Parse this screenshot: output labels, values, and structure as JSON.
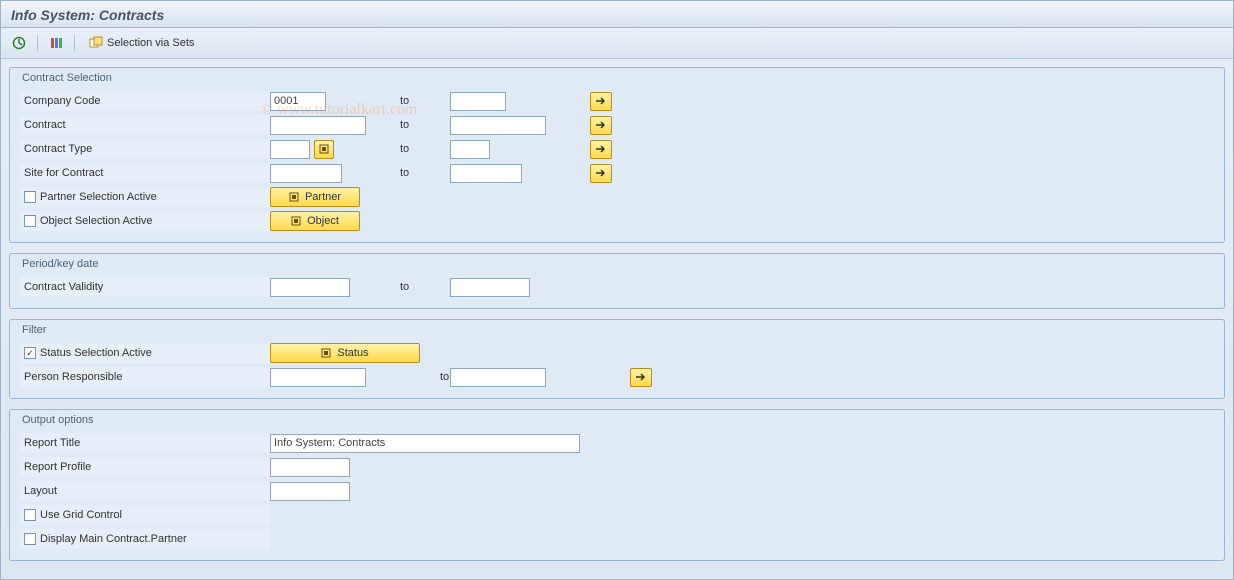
{
  "title": "Info System: Contracts",
  "toolbar": {
    "selection_via_sets": "Selection via Sets"
  },
  "watermark": "© www.tutorialkart.com",
  "contract_selection": {
    "legend": "Contract Selection",
    "rows": {
      "company_code": {
        "label": "Company Code",
        "from": "0001",
        "to_lbl": "to",
        "to": ""
      },
      "contract": {
        "label": "Contract",
        "from": "",
        "to_lbl": "to",
        "to": ""
      },
      "contract_type": {
        "label": "Contract Type",
        "from": "",
        "to_lbl": "to",
        "to": ""
      },
      "site": {
        "label": "Site for Contract",
        "from": "",
        "to_lbl": "to",
        "to": ""
      }
    },
    "partner_active": {
      "label": "Partner Selection Active",
      "checked": false,
      "btn": "Partner"
    },
    "object_active": {
      "label": "Object Selection Active",
      "checked": false,
      "btn": "Object"
    }
  },
  "period": {
    "legend": "Period/key date",
    "validity": {
      "label": "Contract Validity",
      "from": "",
      "to_lbl": "to",
      "to": ""
    }
  },
  "filter": {
    "legend": "Filter",
    "status_active": {
      "label": "Status Selection Active",
      "checked": true,
      "btn": "Status"
    },
    "person": {
      "label": "Person Responsible",
      "from": "",
      "to_lbl": "to",
      "to": ""
    }
  },
  "output": {
    "legend": "Output options",
    "report_title": {
      "label": "Report Title",
      "value": "Info System: Contracts"
    },
    "report_profile": {
      "label": "Report Profile",
      "value": ""
    },
    "layout": {
      "label": "Layout",
      "value": ""
    },
    "grid": {
      "label": "Use Grid Control",
      "checked": false
    },
    "display_main": {
      "label": "Display Main Contract.Partner",
      "checked": false
    }
  }
}
